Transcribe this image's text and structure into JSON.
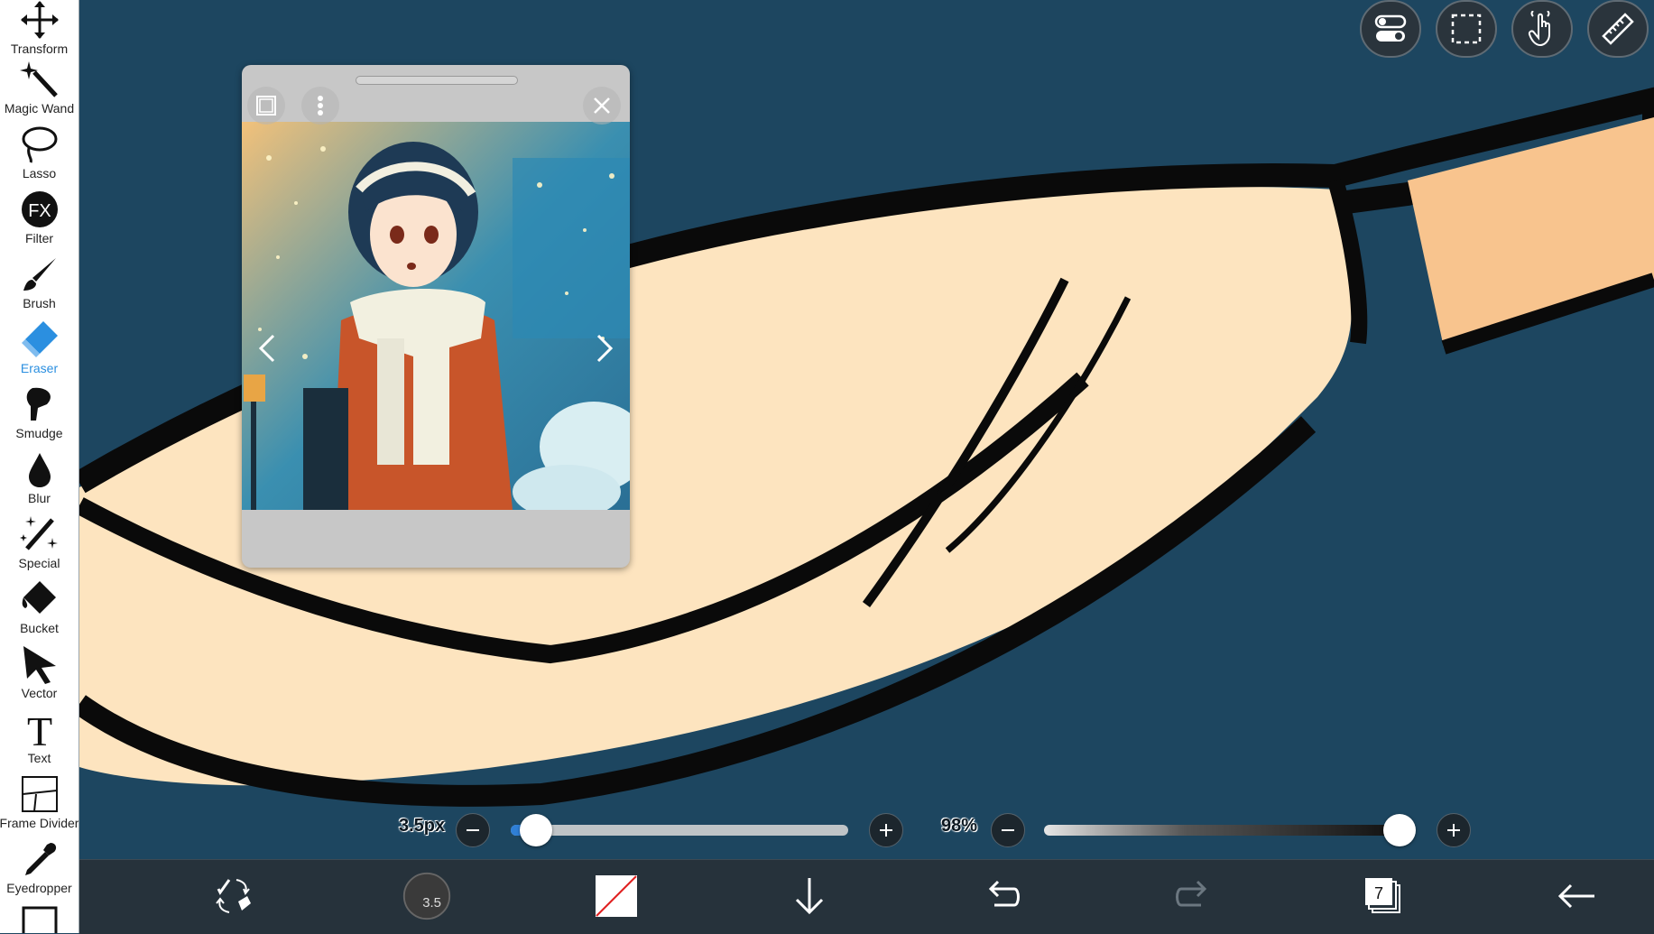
{
  "toolbar": {
    "tools": [
      {
        "label": "Transform",
        "icon": "transform-icon"
      },
      {
        "label": "Magic Wand",
        "icon": "magic-wand-icon"
      },
      {
        "label": "Lasso",
        "icon": "lasso-icon"
      },
      {
        "label": "Filter",
        "icon": "filter-icon",
        "badge": "FX"
      },
      {
        "label": "Brush",
        "icon": "brush-icon"
      },
      {
        "label": "Eraser",
        "icon": "eraser-icon",
        "active": true
      },
      {
        "label": "Smudge",
        "icon": "smudge-icon"
      },
      {
        "label": "Blur",
        "icon": "blur-icon"
      },
      {
        "label": "Special",
        "icon": "special-icon"
      },
      {
        "label": "Bucket",
        "icon": "bucket-icon"
      },
      {
        "label": "Vector",
        "icon": "vector-icon"
      },
      {
        "label": "Text",
        "icon": "text-icon",
        "glyph": "T"
      },
      {
        "label": "Frame Divider",
        "icon": "frame-divider-icon"
      },
      {
        "label": "Eyedropper",
        "icon": "eyedropper-icon"
      }
    ],
    "active_color": "#2b8fe0"
  },
  "top_buttons": [
    "toggle-icon",
    "selection-icon",
    "hand-icon",
    "ruler-icon"
  ],
  "reference_window": {
    "buttons": [
      "frame-icon",
      "more-vertical-icon",
      "close-icon"
    ],
    "prev": "<",
    "next": ">"
  },
  "brush_size": {
    "label": "3.5px",
    "fraction": 0.02
  },
  "opacity": {
    "label": "98%",
    "fraction": 0.98
  },
  "bottom_bar": {
    "brush_preview_value": "3.5",
    "layer_count": "7",
    "icons": [
      "swap-tool-icon",
      "brush-preview-icon",
      "color-swatch-icon",
      "download-icon",
      "undo-icon",
      "redo-icon",
      "layers-icon",
      "back-icon"
    ]
  },
  "colors": {
    "canvas_bg": "#1d4660",
    "skin": "#fde4bf",
    "skin_orange": "#f8c48e",
    "outline": "#0a0a0a"
  }
}
